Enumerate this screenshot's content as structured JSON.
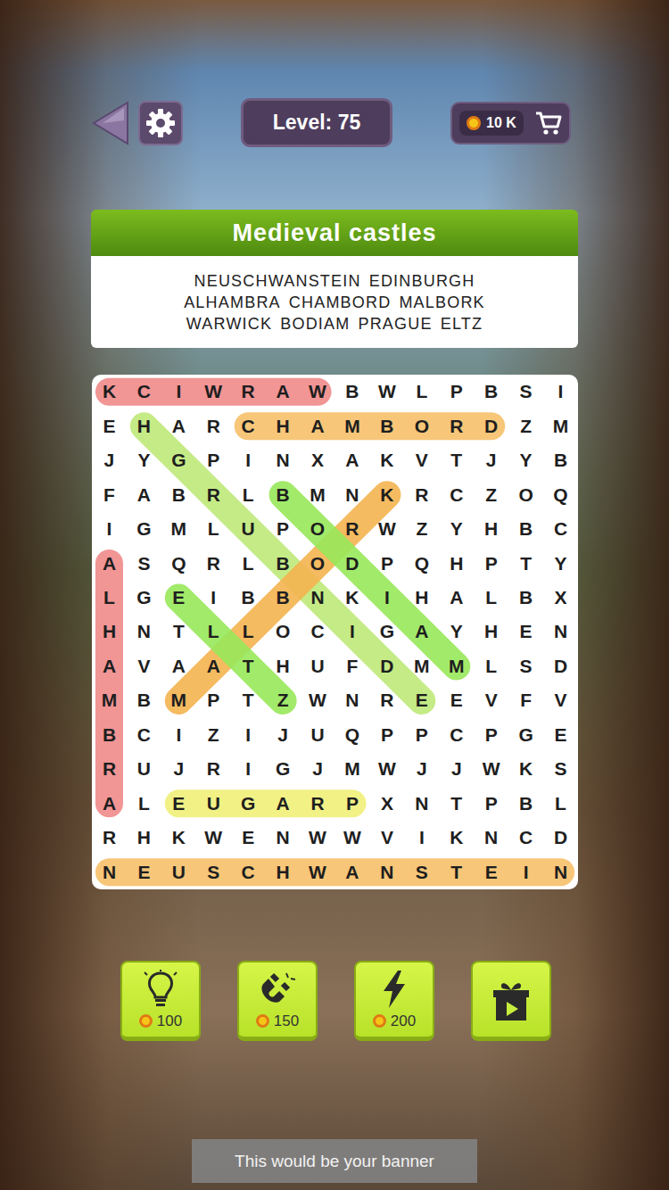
{
  "header": {
    "level": "Level: 75",
    "coins": "10 K"
  },
  "category": "Medieval castles",
  "word_rows": [
    [
      {
        "text": "NEUSCHWANSTEIN",
        "found": true,
        "from": [
          14,
          0
        ],
        "to": [
          14,
          13
        ],
        "color": "#f7c06a"
      },
      {
        "text": "EDINBURGH",
        "found": true,
        "from": [
          9,
          9
        ],
        "to": [
          1,
          1
        ],
        "color": "#bfe97a"
      }
    ],
    [
      {
        "text": "ALHAMBRA",
        "found": true,
        "from": [
          5,
          0
        ],
        "to": [
          12,
          0
        ],
        "color": "#f08a8a"
      },
      {
        "text": "CHAMBORD",
        "found": true,
        "from": [
          1,
          4
        ],
        "to": [
          1,
          11
        ],
        "color": "#f7c06a"
      },
      {
        "text": "MALBORK",
        "found": true,
        "from": [
          9,
          2
        ],
        "to": [
          3,
          8
        ],
        "color": "#f5b450"
      }
    ],
    [
      {
        "text": "WARWICK",
        "found": true,
        "from": [
          0,
          6
        ],
        "to": [
          0,
          0
        ],
        "color": "#f08a8a"
      },
      {
        "text": "BODIAM",
        "found": true,
        "from": [
          3,
          5
        ],
        "to": [
          8,
          10
        ],
        "color": "#98e85a"
      },
      {
        "text": "PRAGUE",
        "found": true,
        "from": [
          12,
          7
        ],
        "to": [
          12,
          2
        ],
        "color": "#f0f07a"
      },
      {
        "text": "ELTZ",
        "found": true,
        "from": [
          6,
          2
        ],
        "to": [
          9,
          5
        ],
        "color": "#98e85a"
      }
    ]
  ],
  "grid": [
    "KCIWRAWBWLPBSI",
    "EHARCHAMBORDZM",
    "JYGPINXAKVTJYB",
    "FABRLBMNKRCZOQ",
    "IGMLUPORWZYHBC",
    "ASQRLBODPQHPTY",
    "LGEIBBNKIHALBX",
    "HNTLLOCIGAYHEN",
    "AVAATHUFDMMLSD",
    "MBMPTZWNREEVFV",
    "BCIZIJUQPPCPGE",
    "RUJRIGJMWJJWKS",
    "ALEUGARPXNTPBL",
    "RHKWENWWVIKNCD",
    "NEUSCHWANSTEIN"
  ],
  "powerups": [
    {
      "kind": "hint",
      "price": "100"
    },
    {
      "kind": "magnet",
      "price": "150"
    },
    {
      "kind": "lightning",
      "price": "200"
    },
    {
      "kind": "video",
      "price": ""
    }
  ],
  "banner": "This would be your banner"
}
